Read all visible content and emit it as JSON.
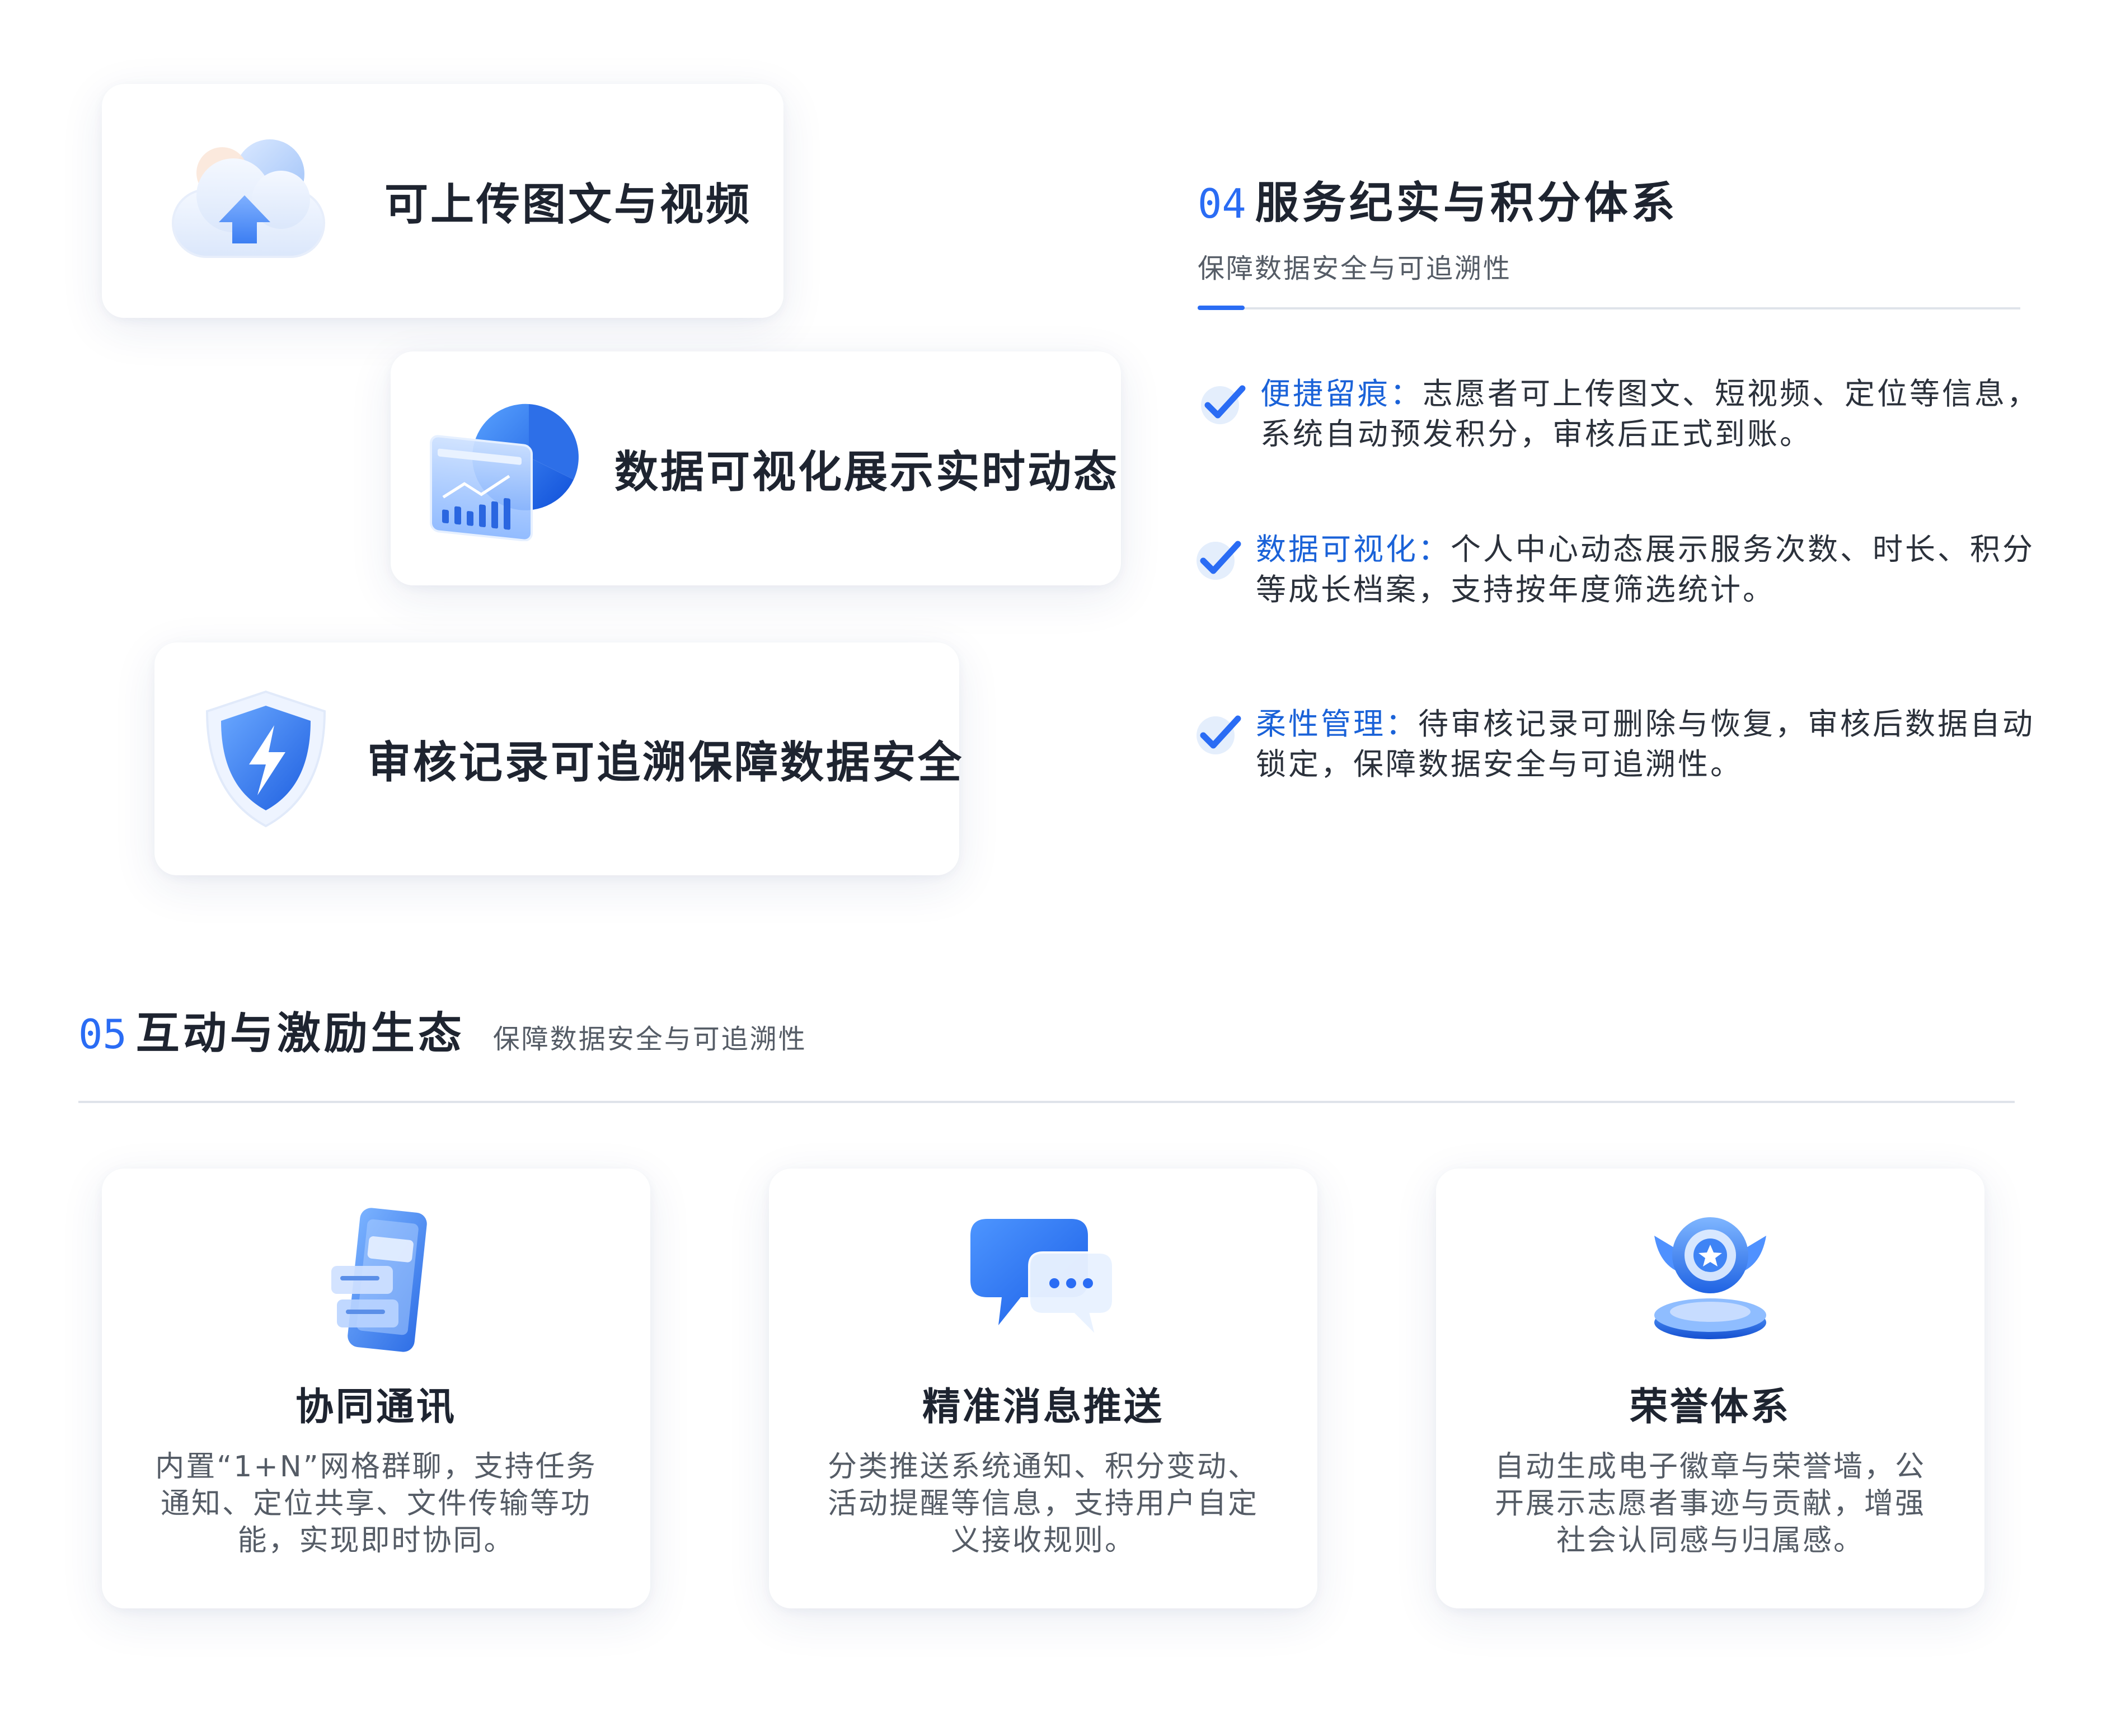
{
  "feature_cards": {
    "upload": {
      "title": "可上传图文与视频",
      "icon": "cloud-upload-icon"
    },
    "visualization": {
      "title": "数据可视化展示实时动态",
      "icon": "chart-pie-icon"
    },
    "security": {
      "title": "审核记录可追溯保障数据安全",
      "icon": "shield-bolt-icon"
    }
  },
  "section04": {
    "number": "04",
    "title": "服务纪实与积分体系",
    "subtitle": "保障数据安全与可追溯性",
    "items": [
      {
        "label": "便捷留痕：",
        "text": "志愿者可上传图文、短视频、定位等信息，系统自动预发积分，审核后正式到账。"
      },
      {
        "label": "数据可视化：",
        "text": "个人中心动态展示服务次数、时长、积分等成长档案，支持按年度筛选统计。"
      },
      {
        "label": "柔性管理：",
        "text": "待审核记录可删除与恢复，审核后数据自动锁定，保障数据安全与可追溯性。"
      }
    ]
  },
  "section05": {
    "number": "05",
    "title": "互动与激励生态",
    "subtitle": "保障数据安全与可追溯性",
    "cards": [
      {
        "title": "协同通讯",
        "desc": "内置“1+N”网格群聊，支持任务通知、定位共享、文件传输等功能，实现即时协同。",
        "icon": "phone-chat-icon"
      },
      {
        "title": "精准消息推送",
        "desc": "分类推送系统通知、积分变动、活动提醒等信息，支持用户自定义接收规则。",
        "icon": "message-bubble-icon"
      },
      {
        "title": "荣誉体系",
        "desc": "自动生成电子徽章与荣誉墙，公开展示志愿者事迹与贡献，增强社会认同感与归属感。",
        "icon": "badge-medal-icon"
      }
    ]
  },
  "colors": {
    "accent": "#2a6cf4",
    "highlight": "#1a62d8",
    "title": "#1e2430",
    "text": "#555c66"
  }
}
